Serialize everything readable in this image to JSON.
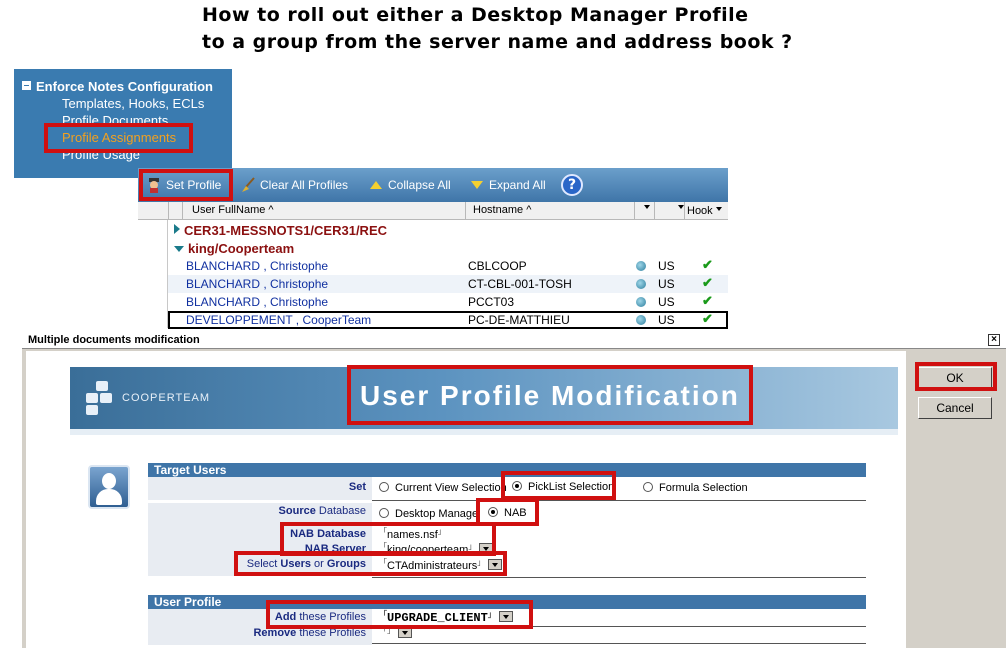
{
  "heading": {
    "line1": "How to roll out either a Desktop Manager Profile",
    "line2": "to a group from the server name and address book ?"
  },
  "navigator": {
    "title": "Enforce Notes Configuration",
    "items": [
      {
        "label": "Templates, Hooks, ECLs"
      },
      {
        "label": "Profile Documents"
      },
      {
        "label": "Profile Assignments"
      },
      {
        "label": "Profile Usage"
      }
    ]
  },
  "toolbar": {
    "set_profile": "Set Profile",
    "clear_all": "Clear All Profiles",
    "collapse_all": "Collapse All",
    "expand_all": "Expand All",
    "help": "?"
  },
  "table": {
    "columns": {
      "user_fullname": "User FullName ^",
      "hostname": "Hostname ^",
      "hook": "Hook"
    },
    "categories": [
      {
        "label": "CER31-MESSNOTS1/CER31/REC"
      },
      {
        "label": "king/Cooperteam"
      }
    ],
    "rows": [
      {
        "user": "BLANCHARD , Christophe",
        "host": "CBLCOOP",
        "loc": "US"
      },
      {
        "user": "BLANCHARD , Christophe",
        "host": "CT-CBL-001-TOSH",
        "loc": "US"
      },
      {
        "user": "BLANCHARD , Christophe",
        "host": "PCCT03",
        "loc": "US"
      },
      {
        "user": "DEVELOPPEMENT , CooperTeam",
        "host": "PC-DE-MATTHIEU",
        "loc": "US"
      }
    ]
  },
  "dialog": {
    "title": "Multiple documents modification",
    "ok": "OK",
    "cancel": "Cancel",
    "banner_logo": "COOPERTEAM",
    "banner_title": "User Profile Modification",
    "target_users": {
      "header": "Target Users",
      "set_label": "Set",
      "set_options": [
        "Current View Selection",
        "PickList Selection",
        "Formula Selection"
      ],
      "source_label_bold": "Source",
      "source_label_rest": " Database",
      "source_options": [
        "Desktop Manage",
        "NAB"
      ],
      "nab_db_label_1": "NAB",
      "nab_db_label_2": "Database",
      "nab_db_value": "names.nsf",
      "nab_server_label_1": "NAB",
      "nab_server_label_2": "Server",
      "nab_server_value": "king/cooperteam",
      "select_label_1": "Select",
      "select_label_2": "Users",
      "select_label_3": "or",
      "select_label_4": "Groups",
      "select_value": "CTAdministrateurs"
    },
    "user_profile": {
      "header": "User Profile",
      "add_label_1": "Add",
      "add_label_2": "these Profiles",
      "add_value": "UPGRADE_CLIENT",
      "remove_label_1": "Remove",
      "remove_label_2": "these Profiles"
    }
  }
}
